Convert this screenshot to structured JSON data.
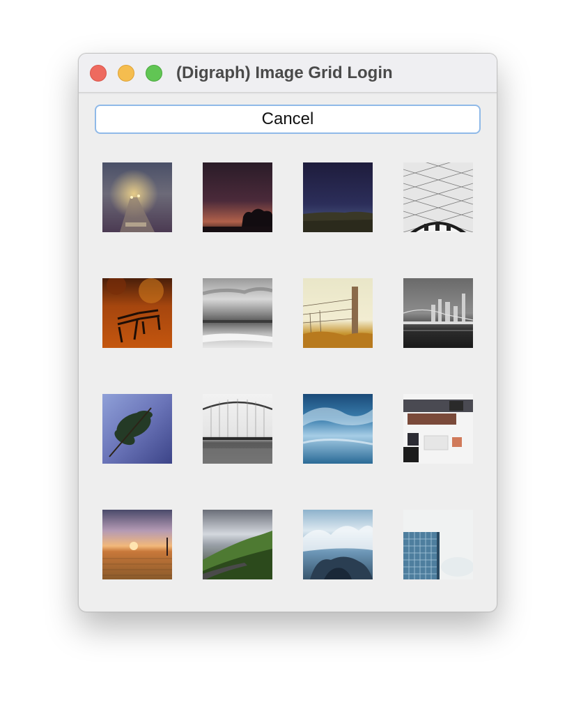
{
  "window": {
    "title": "(Digraph) Image Grid Login"
  },
  "cancel_button": {
    "label": "Cancel"
  },
  "grid": {
    "tiles": [
      {
        "name": "photo-foggy-road-night",
        "icon": "image-icon"
      },
      {
        "name": "photo-dusk-silhouette-trees",
        "icon": "image-icon"
      },
      {
        "name": "photo-night-sky-horizon",
        "icon": "image-icon"
      },
      {
        "name": "photo-glass-dome-ceiling",
        "icon": "image-icon"
      },
      {
        "name": "photo-autumn-park-benches",
        "icon": "image-icon"
      },
      {
        "name": "photo-bw-cloudy-sea",
        "icon": "image-icon"
      },
      {
        "name": "photo-fence-post-field",
        "icon": "image-icon"
      },
      {
        "name": "photo-bw-bridge-city",
        "icon": "image-icon"
      },
      {
        "name": "photo-pine-branch-blue",
        "icon": "image-icon"
      },
      {
        "name": "photo-arch-bridge-bw",
        "icon": "image-icon"
      },
      {
        "name": "photo-blue-ocean-wave",
        "icon": "image-icon"
      },
      {
        "name": "photo-desk-flatlay",
        "icon": "image-icon"
      },
      {
        "name": "photo-sunset-wheat-field",
        "icon": "image-icon"
      },
      {
        "name": "photo-green-hills-road",
        "icon": "image-icon"
      },
      {
        "name": "photo-wave-crash-rocks",
        "icon": "image-icon"
      },
      {
        "name": "photo-glass-building-haze",
        "icon": "image-icon"
      }
    ]
  }
}
